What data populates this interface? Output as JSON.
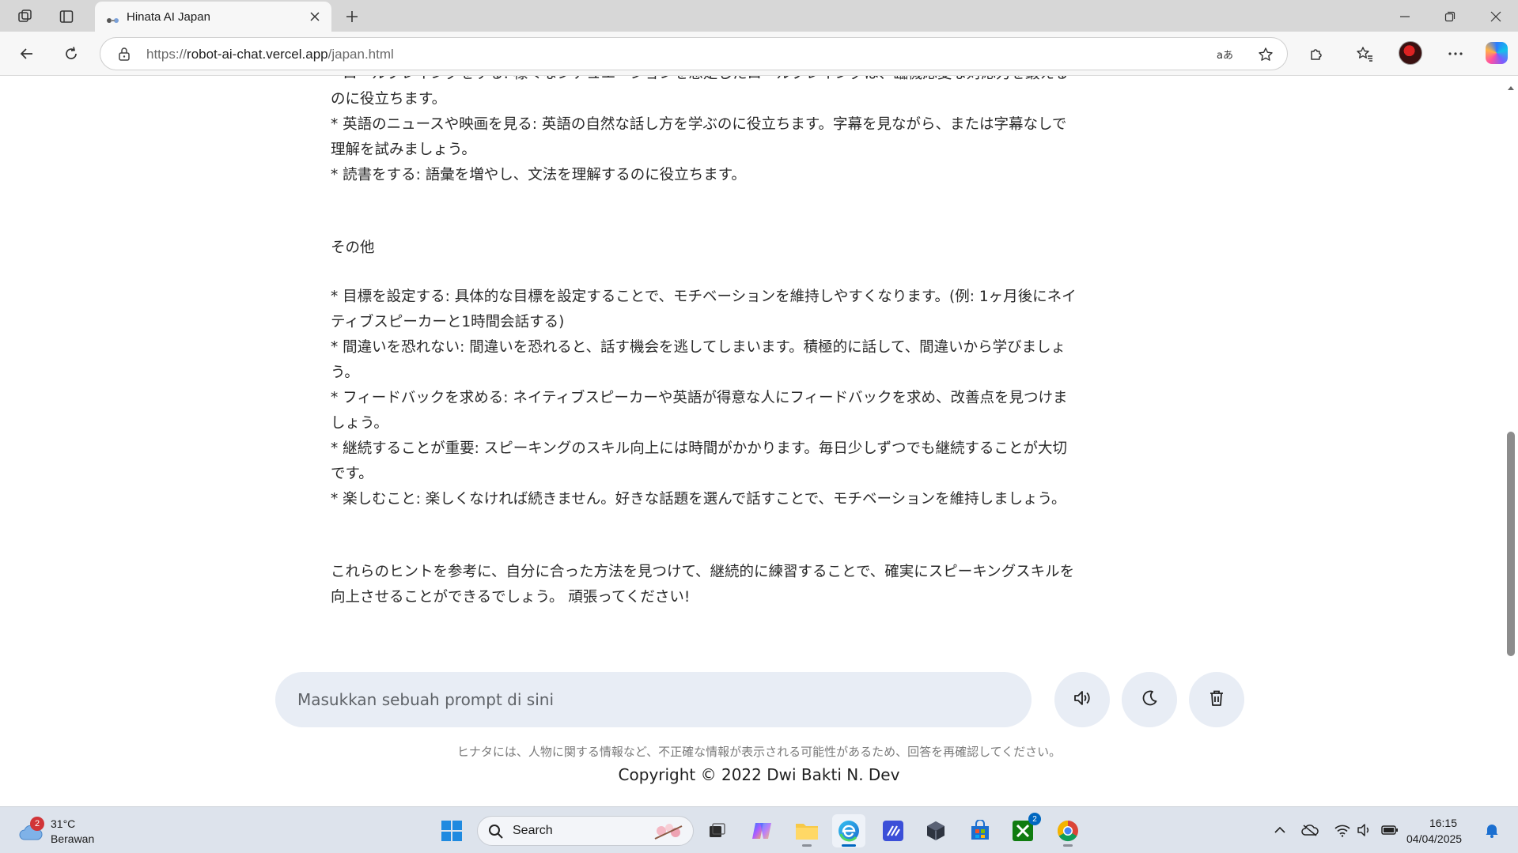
{
  "browser": {
    "tab_title": "Hinata AI Japan",
    "url_prefix": "https://",
    "url_host": "robot-ai-chat.vercel.app",
    "url_path": "/japan.html"
  },
  "content": {
    "top_lines": [
      "* ロールプレイングをする: 様々なシチュエーションを想定したロールプレイングは、臨機応変な対応力を鍛える",
      "のに役立ちます。",
      "* 英語のニュースや映画を見る: 英語の自然な話し方を学ぶのに役立ちます。字幕を見ながら、または字幕なしで",
      "理解を試みましょう。",
      "* 読書をする: 語彙を増やし、文法を理解するのに役立ちます。"
    ],
    "section_heading": "その他",
    "other_lines": [
      "* 目標を設定する: 具体的な目標を設定することで、モチベーションを維持しやすくなります。(例: 1ヶ月後にネイ",
      "ティブスピーカーと1時間会話する)",
      "* 間違いを恐れない: 間違いを恐れると、話す機会を逃してしまいます。積極的に話して、間違いから学びましょ",
      "う。",
      "* フィードバックを求める: ネイティブスピーカーや英語が得意な人にフィードバックを求め、改善点を見つけま",
      "しょう。",
      "* 継続することが重要: スピーキングのスキル向上には時間がかかります。毎日少しずつでも継続することが大切",
      "です。",
      "* 楽しむこと: 楽しくなければ続きません。好きな話題を選んで話すことで、モチベーションを維持しましょう。"
    ],
    "closing_lines": [
      "これらのヒントを参考に、自分に合った方法を見つけて、継続的に練習することで、確実にスピーキングスキルを",
      "向上させることができるでしょう。 頑張ってください!"
    ]
  },
  "chat": {
    "prompt_placeholder": "Masukkan sebuah prompt di sini",
    "disclaimer": "ヒナタには、人物に関する情報など、不正確な情報が表示される可能性があるため、回答を再確認してください。",
    "copyright": "Copyright © 2022 Dwi Bakti N. Dev"
  },
  "taskbar": {
    "weather_badge": "2",
    "weather_temp": "31°C",
    "weather_desc": "Berawan",
    "search_label": "Search",
    "xbox_badge": "2",
    "time": "16:15",
    "date": "04/04/2025"
  },
  "colors": {
    "accent": "#0067c0",
    "prompt_bg": "#e8edf5",
    "taskbar_bg": "#dde3ec"
  },
  "icons": [
    "workspaces-icon",
    "tab-actions-icon",
    "tab-favicon",
    "close-icon",
    "plus-icon",
    "minimize-icon",
    "restore-icon",
    "window-close-icon",
    "back-icon",
    "refresh-icon",
    "lock-icon",
    "read-aloud-icon",
    "favorite-star-icon",
    "extensions-icon",
    "favorites-icon",
    "more-icon",
    "copilot-icon",
    "speaker-icon",
    "moon-icon",
    "trash-icon",
    "windows-start-icon",
    "search-icon",
    "task-view-icon",
    "copilot-app-icon",
    "file-explorer-icon",
    "edge-icon",
    "vscode-icon",
    "cube-app-icon",
    "store-icon",
    "xbox-icon",
    "chrome-icon",
    "chevron-up-icon",
    "onedrive-icon",
    "wifi-icon",
    "volume-icon",
    "battery-icon",
    "notification-bell-icon"
  ]
}
